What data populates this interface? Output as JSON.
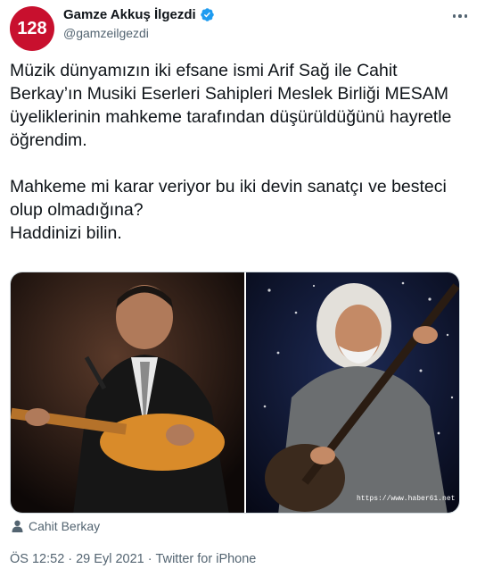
{
  "author": {
    "avatar_text": "128",
    "display_name": "Gamze Akkuş İlgezdi",
    "handle": "@gamzeilgezdi",
    "verified": true
  },
  "tweet": {
    "text": "Müzik dünyamızın iki efsane ismi Arif Sağ ile Cahit Berkay’ın Musiki Eserleri Sahipleri Meslek Birliği MESAM üyeliklerinin mahkeme tarafından düşürüldüğünü hayretle öğrendim.\n\nMahkeme mi karar veriyor bu iki devin sanatçı ve besteci olup olmadığına?\nHaddinizi bilin."
  },
  "media": {
    "watermark": "https://www.haber61.net",
    "tagged_person": "Cahit Berkay"
  },
  "meta": {
    "time": "ÖS 12:52",
    "separator": "·",
    "date": "29 Eyl 2021",
    "source": "Twitter for iPhone"
  },
  "colors": {
    "verified": "#1d9bf0",
    "secondary_text": "#536471",
    "avatar_bg": "#c8102e"
  },
  "icons": [
    "verified-badge-icon",
    "more-icon",
    "person-icon"
  ]
}
